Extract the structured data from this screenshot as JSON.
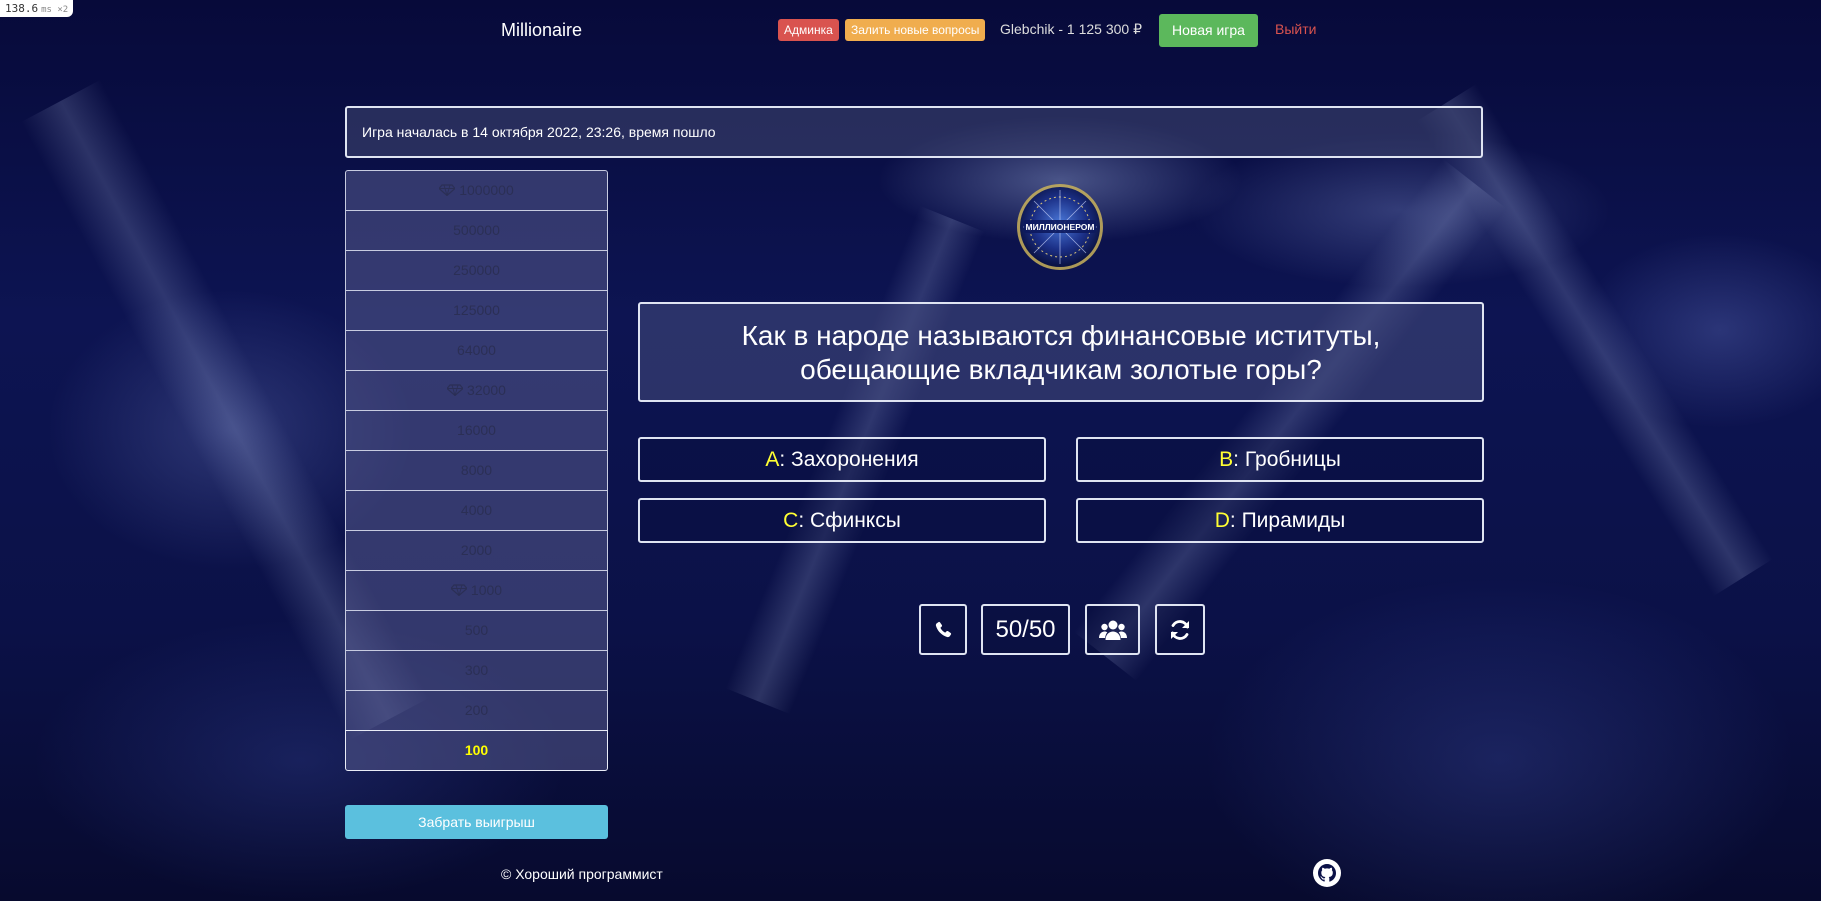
{
  "perf": {
    "value": "138.6",
    "unit": "ms ×2"
  },
  "navbar": {
    "brand": "Millionaire",
    "admin_badge": "Админка",
    "upload_badge": "Залить новые вопросы",
    "user_balance": "Glebchik - 1 125 300 ₽",
    "new_game_label": "Новая игра",
    "logout_label": "Выйти"
  },
  "status": {
    "text": "Игра началась в 14 октября 2022, 23:26, время пошло"
  },
  "prize_ladder": [
    {
      "amount": "1000000",
      "milestone": true,
      "current": false
    },
    {
      "amount": "500000",
      "milestone": false,
      "current": false
    },
    {
      "amount": "250000",
      "milestone": false,
      "current": false
    },
    {
      "amount": "125000",
      "milestone": false,
      "current": false
    },
    {
      "amount": "64000",
      "milestone": false,
      "current": false
    },
    {
      "amount": "32000",
      "milestone": true,
      "current": false
    },
    {
      "amount": "16000",
      "milestone": false,
      "current": false
    },
    {
      "amount": "8000",
      "milestone": false,
      "current": false
    },
    {
      "amount": "4000",
      "milestone": false,
      "current": false
    },
    {
      "amount": "2000",
      "milestone": false,
      "current": false
    },
    {
      "amount": "1000",
      "milestone": true,
      "current": false
    },
    {
      "amount": "500",
      "milestone": false,
      "current": false
    },
    {
      "amount": "300",
      "milestone": false,
      "current": false
    },
    {
      "amount": "200",
      "milestone": false,
      "current": false
    },
    {
      "amount": "100",
      "milestone": false,
      "current": true
    }
  ],
  "take_money_label": "Забрать выигрыш",
  "question": {
    "line1": "Как в народе называются финансовые иституты,",
    "line2": "обещающие вкладчикам золотые горы?"
  },
  "answers": [
    {
      "letter": "A",
      "sep": ":",
      "text": "Захоронения"
    },
    {
      "letter": "B",
      "sep": ":",
      "text": "Гробницы"
    },
    {
      "letter": "C",
      "sep": ":",
      "text": "Сфинксы"
    },
    {
      "letter": "D",
      "sep": ":",
      "text": "Пирамиды"
    }
  ],
  "help": {
    "phone_icon": "phone-icon",
    "fifty_fifty_label": "50/50",
    "audience_icon": "users-icon",
    "swap_icon": "refresh-icon"
  },
  "footer": {
    "text": "© Хороший программист",
    "icon": "github-icon"
  },
  "colors": {
    "admin_badge": "#d9534f",
    "upload_badge": "#f0ad4e",
    "new_game": "#5cb85c",
    "logout": "#d9534f",
    "take_money": "#5bc0de",
    "answer_letter": "#ffff33",
    "current_rung": "#ffff00"
  }
}
